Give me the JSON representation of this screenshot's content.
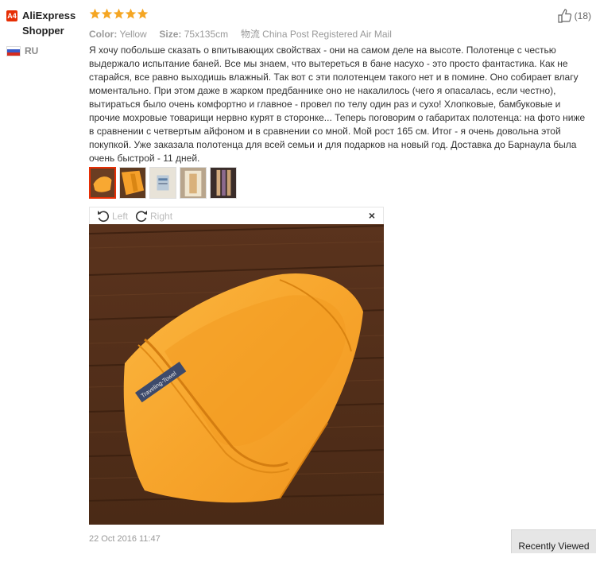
{
  "user": {
    "badge": "A4",
    "name_line1": "AliExpress",
    "name_line2": "Shopper",
    "country": "RU"
  },
  "rating": {
    "stars": 5,
    "max": 5
  },
  "props": {
    "color_label": "Color:",
    "color_value": "Yellow",
    "size_label": "Size:",
    "size_value": "75x135cm",
    "shipping_value": "物流 China Post Registered Air Mail"
  },
  "helpful": {
    "count": "(18)"
  },
  "review_text": "Я хочу побольше сказать о впитывающих свойствах - они на самом деле на высоте. Полотенце с честью выдержало испытание баней. Все мы знаем, что вытереться в бане насухо - это просто фантастика. Как не старайся, все равно выходишь влажный. Так вот с эти полотенцем такого нет и в помине. Оно собирает влагу моментально. При этом даже в жарком предбаннике оно не накалилось (чего я опасалась, если честно), вытираться было очень комфортно и главное - провел по телу один раз и сухо! Хлопковые, бамбуковые и прочие мохровые товарищи нервно курят в сторонке... Теперь поговорим о габаритах полотенца: на фото ниже в сравнении с четвертым айфоном и в сравнении со мной. Мой рост 165 см. Итог - я очень довольна этой покупкой. Уже заказала полотенца для всей семьи и для подарков на новый год. Доставка до Барнаула была очень быстрой - 11 дней.",
  "viewer": {
    "rotate_left": "Left",
    "rotate_right": "Right",
    "close": "×"
  },
  "photo": {
    "label_text": "Traveling-Towel"
  },
  "date": "22 Oct 2016 11:47",
  "recently_viewed": "Recently Viewed",
  "colors": {
    "accent": "#e62e04",
    "star": "#f5a623",
    "towel": "#f8a832"
  }
}
